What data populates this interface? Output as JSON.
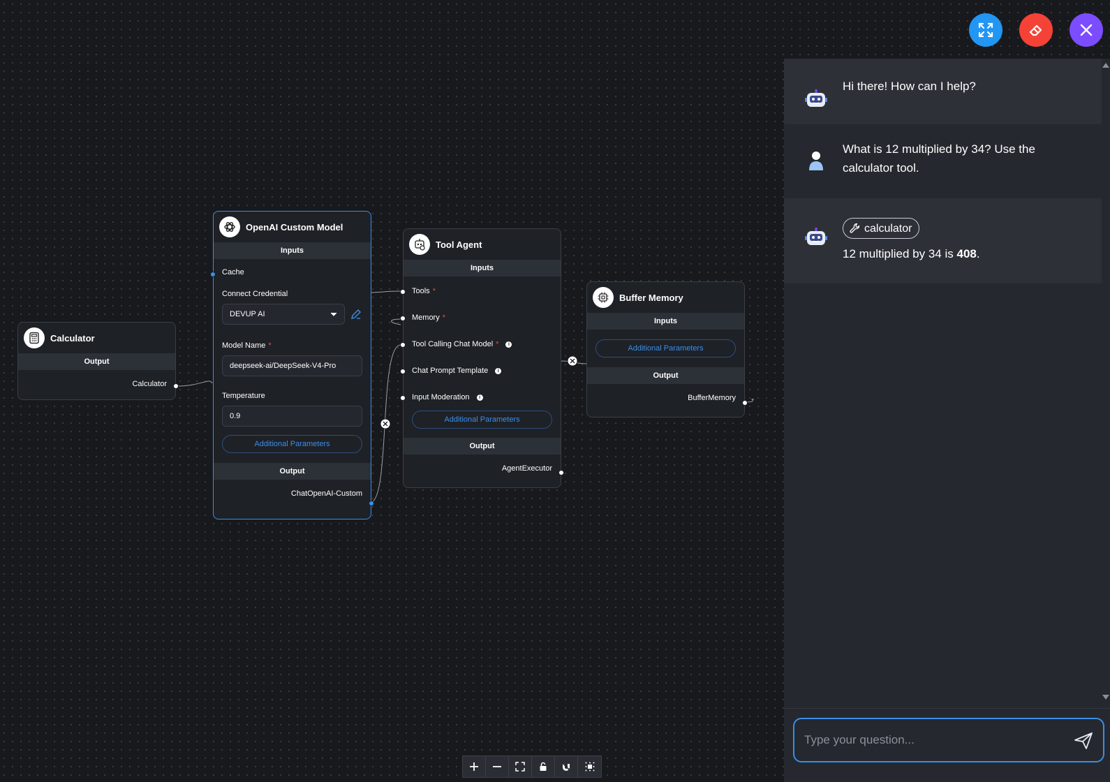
{
  "toolbar": {
    "expand_icon": "expand-icon",
    "clear_icon": "eraser-icon",
    "close_icon": "close-icon",
    "colors": {
      "expand": "#2196f3",
      "clear": "#f44336",
      "close": "#7c4dff"
    }
  },
  "nodes": {
    "calculator": {
      "title": "Calculator",
      "output_section": "Output",
      "output_label": "Calculator"
    },
    "openai": {
      "title": "OpenAI Custom Model",
      "inputs_section": "Inputs",
      "cache_label": "Cache",
      "credential_label": "Connect Credential",
      "credential_value": "DEVUP AI",
      "model_name_label": "Model Name",
      "model_name_value": "deepseek-ai/DeepSeek-V4-Pro",
      "temperature_label": "Temperature",
      "temperature_value": "0.9",
      "additional_params": "Additional Parameters",
      "output_section": "Output",
      "output_label": "ChatOpenAI-Custom",
      "required_mark": "*"
    },
    "tool_agent": {
      "title": "Tool Agent",
      "inputs_section": "Inputs",
      "tools_label": "Tools",
      "memory_label": "Memory",
      "chat_model_label": "Tool Calling Chat Model",
      "prompt_label": "Chat Prompt Template",
      "moderation_label": "Input Moderation",
      "info_mark": "i",
      "additional_params": "Additional Parameters",
      "output_section": "Output",
      "output_label": "AgentExecutor",
      "required_mark": "*"
    },
    "buffer_memory": {
      "title": "Buffer Memory",
      "inputs_section": "Inputs",
      "additional_params": "Additional Parameters",
      "output_section": "Output",
      "output_label": "BufferMemory"
    }
  },
  "chat": {
    "messages": [
      {
        "role": "bot",
        "text": "Hi there! How can I help?"
      },
      {
        "role": "user",
        "text_line1": "What is 12 multiplied by 34? Use the",
        "text_line2": "calculator tool."
      },
      {
        "role": "bot",
        "tool": "calculator",
        "text_prefix": "12 multiplied by 34 is ",
        "text_bold": "408",
        "text_suffix": "."
      }
    ],
    "input_placeholder": "Type your question...",
    "send_icon": "send-icon"
  },
  "controls": [
    "zoom-in-icon",
    "zoom-out-icon",
    "fit-view-icon",
    "lock-icon",
    "snap-icon",
    "background-icon"
  ]
}
